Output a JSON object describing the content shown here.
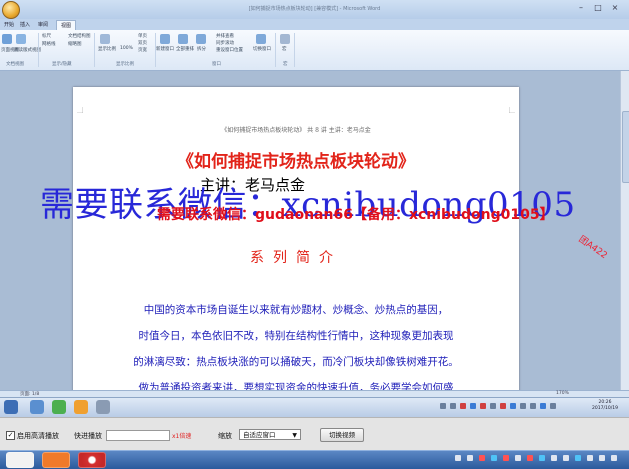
{
  "window": {
    "title": "[如何捕捉市场热点板块轮动] [兼容模式] - Microsoft Word"
  },
  "ribbon": {
    "tabs": [
      "开始",
      "插入",
      "页面布局",
      "引用",
      "邮件",
      "审阅",
      "视图"
    ],
    "active_tab": "视图",
    "groups": [
      {
        "label": "文档视图",
        "items": [
          "页面视图",
          "阅读版式视图"
        ]
      },
      {
        "label": "显示/隐藏",
        "items": [
          "标尺",
          "网格线",
          "文档结构图",
          "缩略图"
        ]
      },
      {
        "label": "显示比例",
        "items": [
          "显示比例",
          "100%",
          "单页",
          "双页",
          "页宽"
        ]
      },
      {
        "label": "窗口",
        "items": [
          "新建窗口",
          "全部重排",
          "拆分",
          "并排查看",
          "同步滚动",
          "重设窗口位置",
          "切换窗口"
        ]
      },
      {
        "label": "宏",
        "items": [
          "宏"
        ]
      }
    ]
  },
  "document": {
    "header_line": "《如何捕捉市场热点板块轮动》   共 8 讲   主讲：老马点金",
    "title": "《如何捕捉市场热点板块轮动》",
    "presenter": "主讲：老马点金",
    "section_title": "系列简介",
    "body_lines": [
      "中国的资本市场自诞生以来就有炒题材、炒概念、炒热点的基因，",
      "时值今日，本色依旧不改，特别在结构性行情中，这种现象更加表现",
      "的淋漓尽致：热点板块涨的可以捅破天，而冷门板块却像铁树难开花。",
      "做为普通投资者来讲，要想实现资金的快速升值，务必要学会如何盛"
    ]
  },
  "watermarks": {
    "blue": "需要联系微信：xcnibudong0105",
    "red": "需要联系微信：gudaonan66【备用：xcnibudong0105】",
    "side": "团A422"
  },
  "statusbar": {
    "page_info": "页面: 1/8",
    "zoom": "170%"
  },
  "clock": {
    "time": "20:26",
    "date": "2017/10/19"
  },
  "player": {
    "hd_checked": true,
    "hd_label": "启用高清播放",
    "ff_label": "快进播放",
    "ff_value": "",
    "speed_label": "x1倍速",
    "zoom_label": "缩放",
    "zoom_value": "自适应窗口",
    "switch_label": "切换视频"
  },
  "colors": {
    "title_red": "#e2241a",
    "body_blue": "#1d1db8",
    "watermark_blue": "#2828d8",
    "watermark_red": "#e00f1a",
    "taskbar": "#2b5a9c"
  }
}
